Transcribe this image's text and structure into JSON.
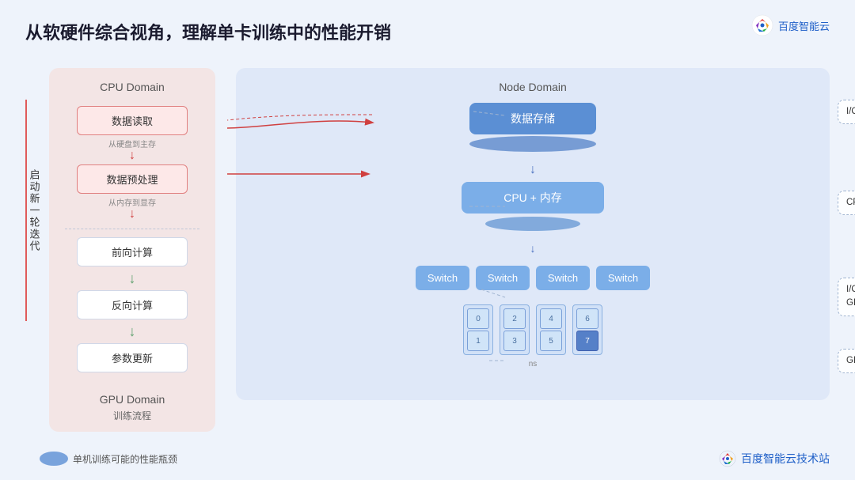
{
  "title": "从软硬件综合视角，理解单卡训练中的性能开销",
  "logo": {
    "text": "百度智能云",
    "icon": "baidu-logo"
  },
  "cpu_domain": {
    "label": "CPU Domain",
    "boxes": [
      {
        "id": "data-read",
        "text": "数据读取",
        "highlight": true
      },
      {
        "id": "data-preprocess",
        "text": "数据预处理",
        "highlight": true
      },
      {
        "id": "forward-compute",
        "text": "前向计算",
        "highlight": false
      },
      {
        "id": "backward-compute",
        "text": "反向计算",
        "highlight": false
      },
      {
        "id": "param-update",
        "text": "参数更新",
        "highlight": false
      }
    ],
    "labels": {
      "disk_to_mem": "从硬盘到主存",
      "mem_to_vram": "从内存到显存"
    },
    "bottom_label": "GPU Domain",
    "bottom_sub": "训练流程"
  },
  "iteration_label": "启动新一轮迭代",
  "node_domain": {
    "label": "Node Domain",
    "storage": "数据存储",
    "cpu_mem": "CPU + 内存",
    "switches": [
      "Switch",
      "Switch",
      "Switch",
      "Switch"
    ],
    "gpu_labels": [
      "0",
      "1",
      "2",
      "3",
      "4",
      "5",
      "6",
      "7"
    ]
  },
  "annotations": {
    "io_storage": "I/O 开销，从存储读",
    "cpu_preprocess": "CPU 数据预处理开销",
    "io_gpu_copy": "I/O 开销，CPU-\nGPU 之间拷贝",
    "gpu_compute": "GPU 计算和显存开销"
  },
  "footer": {
    "legend_text": "单机训练可能的性能瓶颈",
    "brand": "百度智能云技术站",
    "ns_label": "ns"
  }
}
